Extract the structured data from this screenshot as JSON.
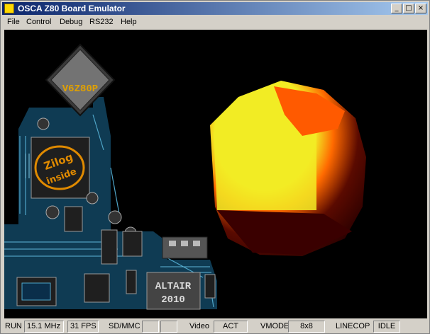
{
  "window": {
    "title": "OSCA Z80 Board Emulator"
  },
  "title_buttons": {
    "minimize": "_",
    "maximize": "□",
    "close": "×"
  },
  "menu": [
    "File",
    "Control",
    "Debug",
    "RS232",
    "Help"
  ],
  "board": {
    "cpu_label": "V6Z80P",
    "logo_line1": "Zilog",
    "logo_line2": "inside",
    "chip_label_1": "ALTAIR",
    "chip_label_2": "2010"
  },
  "status": {
    "run": "RUN",
    "clock": "15.1 MHz",
    "fps": "31 FPS",
    "sd_label": "SD/MMC",
    "sd_value1": "",
    "sd_value2": "",
    "video_label": "Video",
    "video_value": "ACT",
    "vmode_label": "VMODE",
    "vmode_value": "8x8",
    "linecop_label": "LINECOP",
    "linecop_value": "IDLE"
  },
  "colors": {
    "title_gradient_start": "#0a246a",
    "title_gradient_end": "#a6caf0",
    "board_blue": "#0f3b53",
    "chip_gold": "#e08a00",
    "sphere_yellow": "#f2ec24",
    "sphere_orange": "#ff6a00",
    "sphere_red": "#3a0000"
  }
}
